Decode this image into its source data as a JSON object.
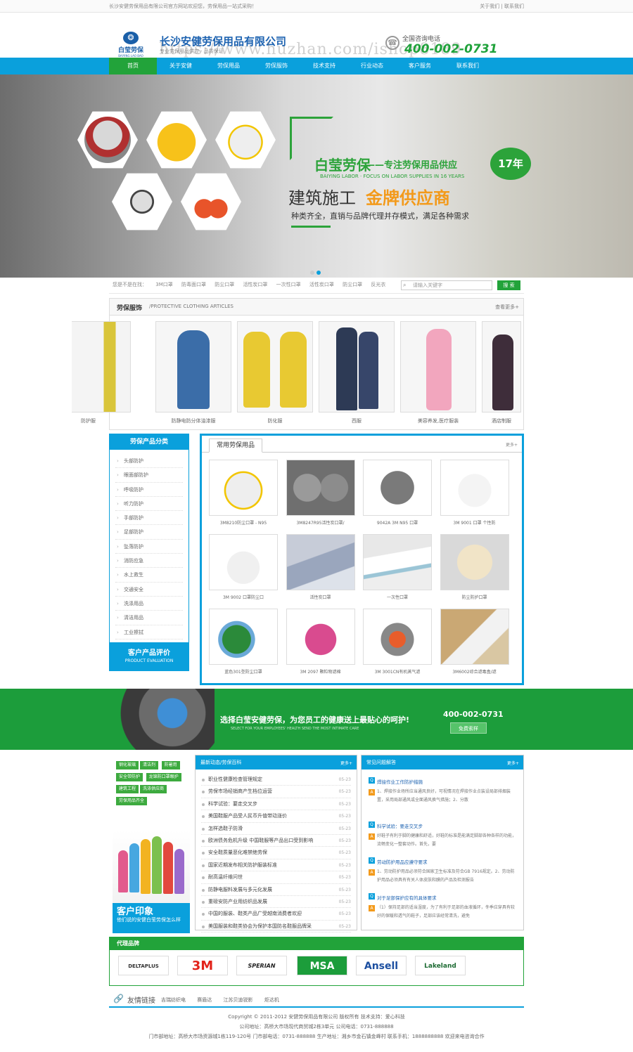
{
  "topbar": {
    "welcome": "长沙安健劳保用品有限公司官方网站欢迎您，劳保用品一站式采购！",
    "about": "关于我们",
    "contact": "联系我们"
  },
  "header": {
    "logo_cn": "白莹劳保",
    "logo_en": "BAIYING LAO BAO",
    "company": "长沙安健劳保用品有限公司",
    "subtitle": "专业劳保用品供应 · 品质保证",
    "watermark": "https://www.huzhan.com/ishop8189",
    "phone_label": "全国咨询电话",
    "phone": "400-002-0731"
  },
  "nav": [
    "首页",
    "关于安健",
    "劳保用品",
    "劳保服饰",
    "技术支持",
    "行业动态",
    "客户服务",
    "联系我们"
  ],
  "banner": {
    "brand": "白莹劳保",
    "tagline": "——专注劳保用品供应",
    "years": "17年",
    "en": "BAIYING LABOR · FOCUS ON LABOR SUPPLIES IN 16 YEARS",
    "headline_a": "建筑施工",
    "headline_b": "金牌供应商",
    "desc": "种类齐全，直销与品牌代理并存模式，满足各种需求"
  },
  "search": {
    "label": "您是不是在找：",
    "hot": [
      "3M口罩",
      "防毒面口罩",
      "防尘口罩",
      "活性炭口罩",
      "一次性口罩",
      "活性炭口罩",
      "防尘口罩",
      "反光衣"
    ],
    "placeholder": "请输入关键字",
    "button": "搜 索"
  },
  "clothing": {
    "title": "劳保服饰",
    "subtitle": "/PROTECTIVE CLOTHING ARTICLES",
    "more": "查看更多+",
    "items": [
      "防护服",
      "防静电防分体油漆服",
      "防化服",
      "西服",
      "美容养发,医疗服装",
      "酒店制服"
    ]
  },
  "categories": {
    "title": "劳保产品分类",
    "items": [
      "头部防护",
      "眼面部防护",
      "呼吸防护",
      "听力防护",
      "手部防护",
      "足部防护",
      "坠落防护",
      "消防应急",
      "水上救生",
      "交通安全",
      "洗涤用品",
      "清洁用品",
      "工业擦拭"
    ],
    "eval_title": "客户产品评价",
    "eval_en": "PRODUCT EVALUATION"
  },
  "products": {
    "title": "常用劳保用品",
    "more": "更多+",
    "items": [
      "3M8210防尘口罩 - N95",
      "3M8247R95活性炭口罩/",
      "9042A 3M N95 口罩",
      "3M 9001 口罩 个性防",
      "3M 9002 口罩防尘口",
      "活性炭口罩",
      "一次性口罩",
      "防尘防护口罩",
      "蓝色301型防尘口罩",
      "3M 2097 颗粒物滤棉",
      "3M 3001CN有机蒸气滤",
      "3M6002综合滤毒盒/滤"
    ]
  },
  "promo": {
    "slogan": "选择白莹安健劳保，为您员工的健康送上最贴心的呵护!",
    "en": "SELECT FOR YOUR EMPLOYEES' HEALTH SEND THE MOST INTIMATE CARE",
    "tel": "400-002-0731",
    "button": "免费索样"
  },
  "tags": [
    "钢化玻璃",
    "清洁剂",
    "防暑用",
    "安全带防护",
    "龙锦防口罩眼护",
    "建筑工程",
    "洗涤供应商",
    "劳保用品齐全"
  ],
  "impression": {
    "title": "客户印象",
    "sub": "他们说的安健白莹劳保怎么样"
  },
  "news": {
    "title": "最新动态/劳保百科",
    "more": "更多+",
    "items": [
      [
        "职业性健康检查管理规定",
        "05-23"
      ],
      [
        "劳保市场经销商产生档位运营",
        "05-23"
      ],
      [
        "科学试验：要走交叉步",
        "05-23"
      ],
      [
        "美国鞋服产品受人民币升值带动涨价",
        "05-23"
      ],
      [
        "怎样选鞋子防滑",
        "05-23"
      ],
      [
        "欧洲债务危机升级 中国鞋服等产品出口受到影响",
        "05-23"
      ],
      [
        "安全鞋质量恶化难禁绝劳保",
        "05-23"
      ],
      [
        "国家近期发布相关防护服装标准",
        "05-23"
      ],
      [
        "耐高温纤维问世",
        "05-23"
      ],
      [
        "防静电服料发展与多元化发展",
        "05-23"
      ],
      [
        "重磅安防产业用纺织品发展",
        "05-23"
      ],
      [
        "中国的服装、鞋类产品广受越南消费者欢迎",
        "05-23"
      ],
      [
        "美国服装和鞋类协会为保护本国防名鞋服品牌采",
        "05-23"
      ]
    ]
  },
  "faq": {
    "title": "常见问题解答",
    "more": "更多+",
    "items": [
      {
        "q": "焊接作业工作防护措施",
        "a": "1、焊接作业场所应当通风良好，可视情况在焊接作业点装设局部排烟装置，采用局部通风或全面通风换气措施；2、分散"
      },
      {
        "q": "科学试验：要走交叉步",
        "a": "好鞋子有利于脚的健康和舒适，好鞋的标准是能满足脚部各种各样的功能，流畅变化一整套动作。首先，要"
      },
      {
        "q": "劳动防护用品应遵守要求",
        "a": "1、劳动防护用品必须符合国家卫生标准及符合GB 7916规定。2、劳动防护用品必须具有有关人体皮肤和膜的产品及检测报告"
      },
      {
        "q": "对于足部保护应有的具体要求",
        "a": "（1）保持足部的适当湿度，为了有利于足部的血液循环，冬季应穿具有较好的保暖和透气的鞋子，足部应该经常清洗，避免"
      }
    ]
  },
  "brands": {
    "title": "代理品牌",
    "items": [
      "DELTAPLUS",
      "3M",
      "SPERIAN",
      "MSA",
      "Ansell",
      "Lakeland"
    ]
  },
  "links": {
    "title": "友情链接",
    "items": [
      "吉瑞纺织电",
      "赛盾达",
      "江苏贝迪锐影",
      "炬达机"
    ]
  },
  "footer": {
    "line1": "Copyright © 2011-2012  安健劳保用品有限公司  版权所有  技术支持：爱心科技",
    "line2": "公司地址：高桥大市场现代商贸城2栋3单元  公司电话：0731-888888",
    "line3": "门市部地址：高桥大市场资源城1栋119-120号  门市部电话：0731-888888  生产地址：湘乡市金石镇金峰村  联系手机：1888888888  欢迎来电咨询合作"
  }
}
